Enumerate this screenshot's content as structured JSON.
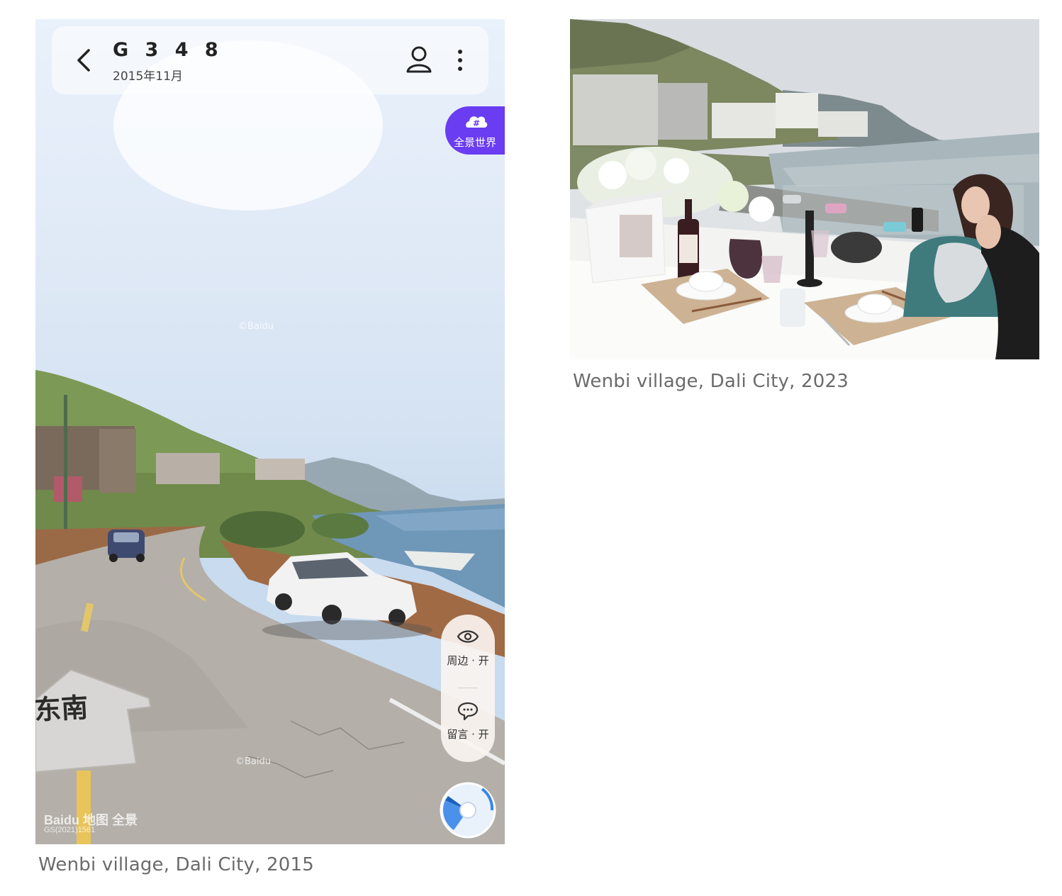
{
  "left_figure": {
    "caption": "Wenbi village, Dali City, 2015",
    "street_view": {
      "road_name": "G 3 4 8",
      "date": "2015年11月",
      "panorama_badge": {
        "icon": "panorama-world-icon",
        "label": "全景世界"
      },
      "direction_arrow_label": "东南",
      "side_controls": [
        {
          "icon": "eye-icon",
          "label": "周边 · 开"
        },
        {
          "icon": "speech-bubble-icon",
          "label": "留言 · 开"
        }
      ],
      "watermark_center": "©Baidu",
      "watermark_bottom": "©Baidu",
      "logo_text": "Baidu 地图 全景",
      "license_code": "GS(2021)1561"
    }
  },
  "right_figure": {
    "caption": "Wenbi village, Dali City, 2023",
    "photo": "lakeside-dinner-table-photo"
  },
  "colors": {
    "caption": "#6b6b6b",
    "badge_purple": "#6a3cf2",
    "compass_blue": "#3a86e8"
  }
}
